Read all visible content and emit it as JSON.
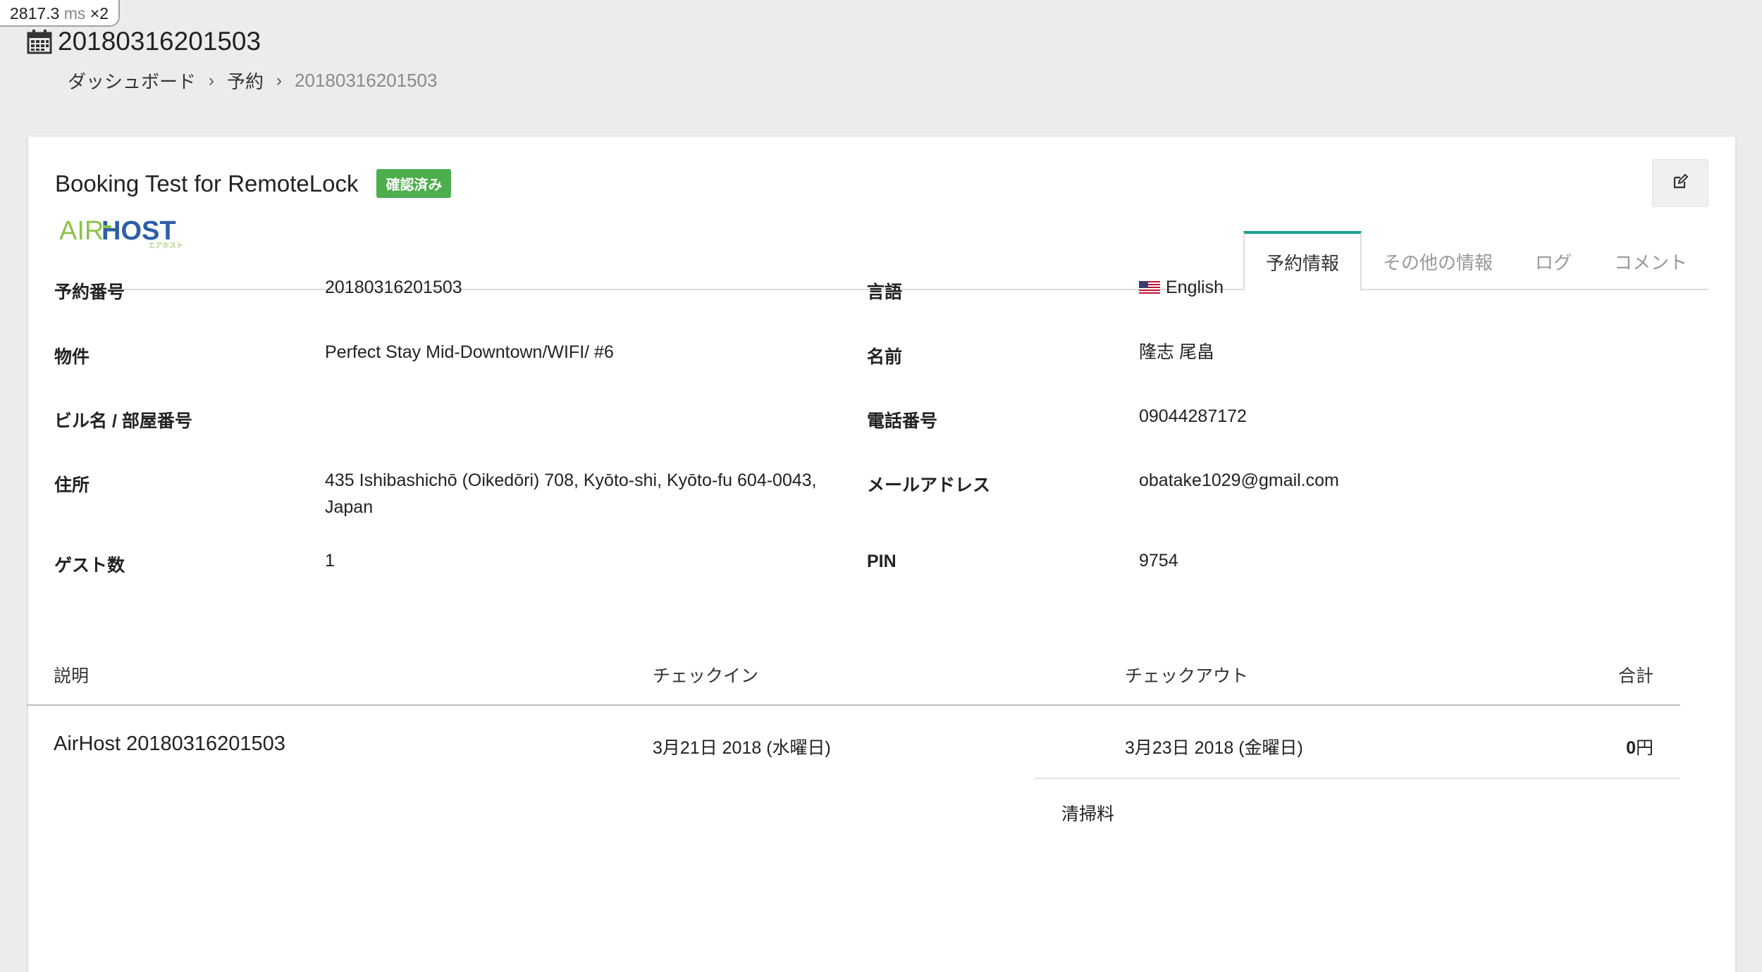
{
  "perf": {
    "value": "2817.3",
    "unit": "ms",
    "multiplier": "×2"
  },
  "header": {
    "title": "20180316201503",
    "icon": "calendar-icon"
  },
  "breadcrumb": {
    "items": [
      "ダッシュボード",
      "予約"
    ],
    "separator": "›",
    "current": "20180316201503"
  },
  "booking": {
    "title": "Booking Test for RemoteLock",
    "status": "確認済み",
    "status_color": "#4cae4c"
  },
  "tabs": [
    {
      "label": "予約情報",
      "active": true
    },
    {
      "label": "その他の情報",
      "active": false
    },
    {
      "label": "ログ",
      "active": false
    },
    {
      "label": "コメント",
      "active": false
    }
  ],
  "logo": {
    "air": "AIR",
    "host": "HOST",
    "kana": "エアホスト"
  },
  "info": {
    "reservation_number": {
      "label": "予約番号",
      "value": "20180316201503"
    },
    "language": {
      "label": "言語",
      "value": "English",
      "flag": "us-flag-icon"
    },
    "property": {
      "label": "物件",
      "value": "Perfect Stay Mid-Downtown/WIFI/ #6"
    },
    "name": {
      "label": "名前",
      "value": "隆志 尾畠"
    },
    "building": {
      "label": "ビル名 / 部屋番号",
      "value": ""
    },
    "phone": {
      "label": "電話番号",
      "value": "09044287172"
    },
    "address": {
      "label": "住所",
      "value": "435 Ishibashichō (Oikedōri) 708, Kyōto-shi, Kyōto-fu 604-0043, Japan"
    },
    "email": {
      "label": "メールアドレス",
      "value": "obatake1029@gmail.com"
    },
    "guests": {
      "label": "ゲスト数",
      "value": "1"
    },
    "pin": {
      "label": "PIN",
      "value": "9754"
    }
  },
  "charges": {
    "headers": {
      "description": "説明",
      "checkin": "チェックイン",
      "checkout": "チェックアウト",
      "total": "合計"
    },
    "row": {
      "description": "AirHost 20180316201503",
      "checkin": "3月21日 2018 (水曜日)",
      "checkout": "3月23日 2018 (金曜日)",
      "total_amount": "0",
      "total_unit": "円"
    },
    "sub_item": "清掃料"
  },
  "colors": {
    "accent": "#1ea195",
    "link": "#2a7bd6"
  }
}
